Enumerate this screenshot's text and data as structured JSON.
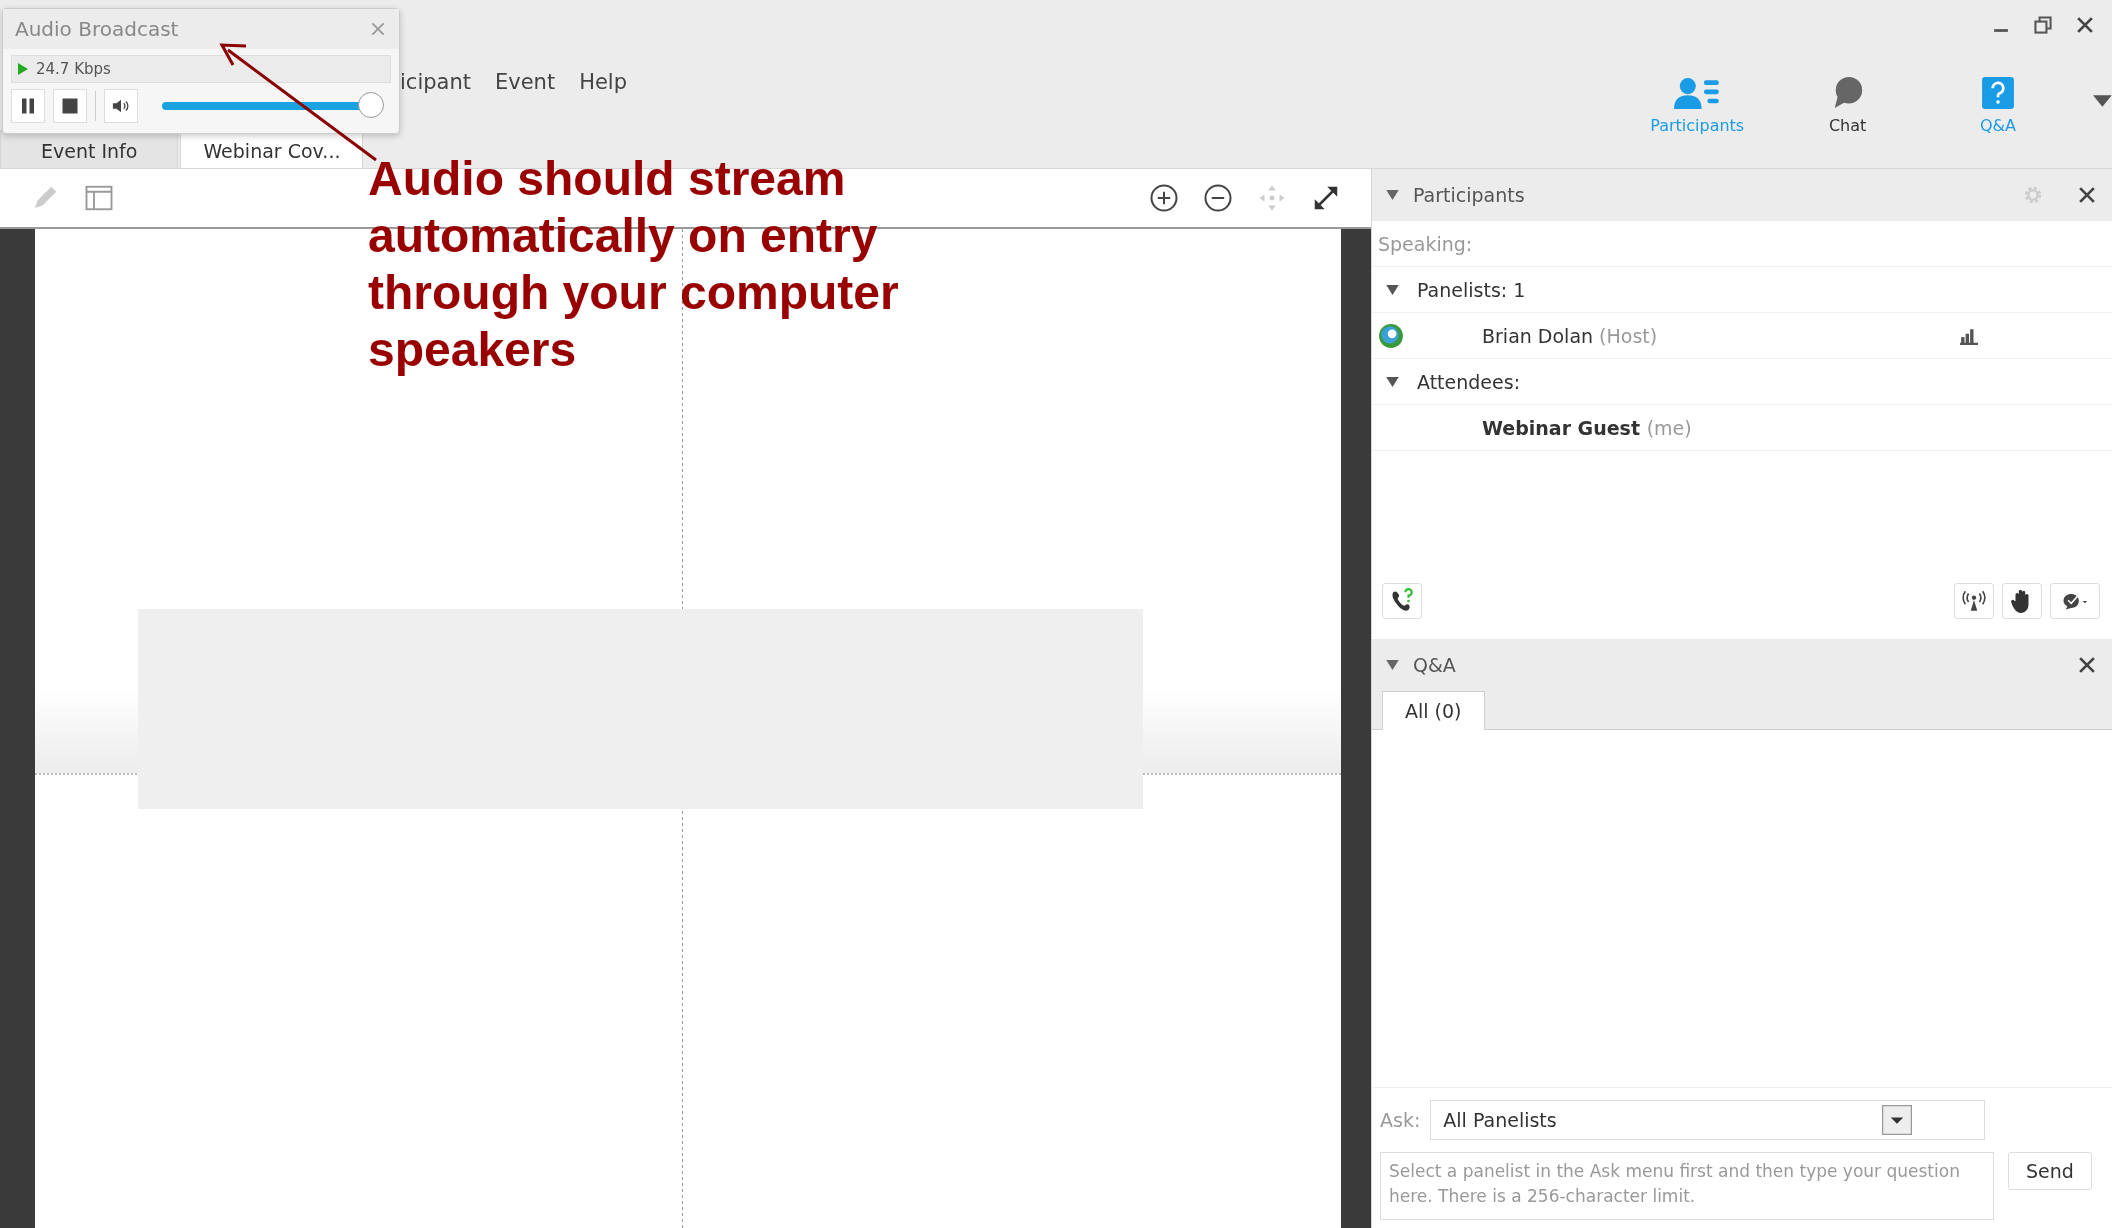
{
  "popup": {
    "title": "Audio Broadcast",
    "bitrate": "24.7 Kbps",
    "playing": true,
    "volume": {
      "level": 0.95
    }
  },
  "menu": [
    "icipant",
    "Event",
    "Help"
  ],
  "doc_tabs": [
    {
      "label": "Event Info",
      "selected": false
    },
    {
      "label": "Webinar Cov...",
      "selected": true
    }
  ],
  "panel_tabs": [
    {
      "label": "Participants",
      "kind": "participants",
      "selected": true
    },
    {
      "label": "Chat",
      "kind": "chat",
      "selected": false
    },
    {
      "label": "Q&A",
      "kind": "qa",
      "selected": true
    }
  ],
  "participants": {
    "title": "Participants",
    "speaking_label": "Speaking:",
    "groups": [
      {
        "label": "Panelists: 1",
        "expanded": true,
        "members": [
          {
            "name": "Brian Dolan",
            "role": "(Host)",
            "kind": "panelist"
          }
        ]
      },
      {
        "label": "Attendees:",
        "expanded": true,
        "members": [
          {
            "name": "Webinar Guest",
            "role": "(me)",
            "kind": "me"
          }
        ]
      }
    ]
  },
  "qa": {
    "title": "Q&A",
    "tabs": [
      {
        "label": "All (0)",
        "selected": true
      }
    ],
    "ask_label": "Ask:",
    "ask_value": "All Panelists",
    "placeholder": "Select a panelist in the Ask menu first and then type your question here. There is a 256-character limit.",
    "send": "Send"
  },
  "annotation": {
    "lines": [
      "Audio should stream",
      "automatically on entry",
      "through your computer",
      "speakers"
    ]
  }
}
